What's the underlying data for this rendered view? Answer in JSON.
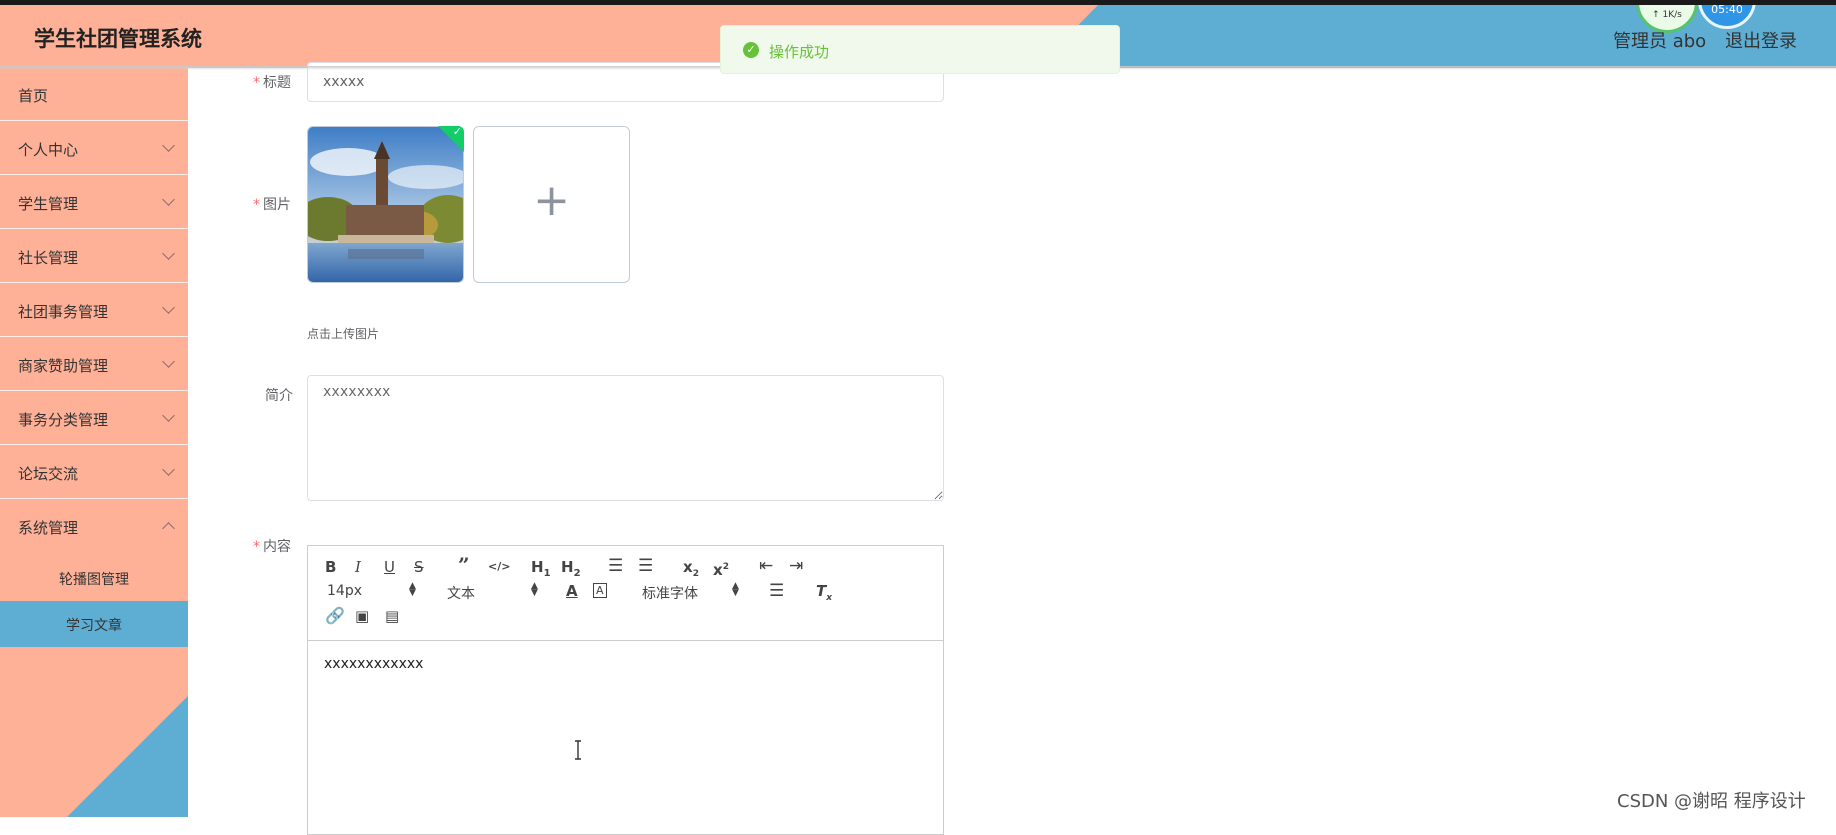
{
  "header": {
    "app_title": "学生社团管理系统",
    "admin_label": "管理员 abo",
    "logout_label": "退出登录",
    "net_speed": "↑ 1K/s",
    "clock": "05:40"
  },
  "toast": {
    "message": "操作成功",
    "type": "success"
  },
  "sidebar": {
    "items": [
      {
        "label": "首页"
      },
      {
        "label": "个人中心"
      },
      {
        "label": "学生管理"
      },
      {
        "label": "社长管理"
      },
      {
        "label": "社团事务管理"
      },
      {
        "label": "商家赞助管理"
      },
      {
        "label": "事务分类管理"
      },
      {
        "label": "论坛交流"
      },
      {
        "label": "系统管理"
      }
    ],
    "submenu": [
      {
        "label": "轮播图管理"
      },
      {
        "label": "学习文章",
        "active": true
      }
    ]
  },
  "form": {
    "title_label": "标题",
    "title_value": "xxxxx",
    "image_label": "图片",
    "upload_tip": "点击上传图片",
    "intro_label": "简介",
    "intro_value": "xxxxxxxx",
    "content_label": "内容",
    "required_mark": "*"
  },
  "editor": {
    "font_size": "14px",
    "header_select": "文本",
    "font_family": "标准字体",
    "content": "xxxxxxxxxxxx"
  },
  "watermark": "CSDN @谢昭  程序设计",
  "colors": {
    "salmon": "#ffb198",
    "blue": "#5eaed4",
    "success": "#67c23a",
    "required": "#f56c6c"
  }
}
